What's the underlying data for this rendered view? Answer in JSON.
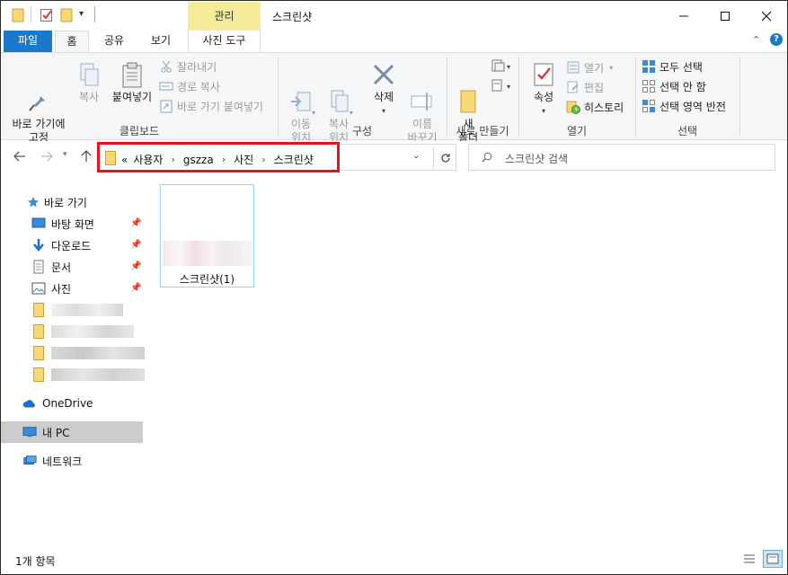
{
  "title_bar": {
    "manage_tab": "관리",
    "window_title": "스크린샷"
  },
  "ribbon_tabs": {
    "file": "파일",
    "home": "홈",
    "share": "공유",
    "view": "보기",
    "picture_tools": "사진 도구"
  },
  "ribbon": {
    "clipboard": {
      "pin_quick_access": "바로 가기에\n고정",
      "copy": "복사",
      "paste": "붙여넣기",
      "cut": "잘라내기",
      "copy_path": "경로 복사",
      "paste_shortcut": "바로 가기 붙여넣기",
      "group_label": "클립보드"
    },
    "organize": {
      "move_to": "이동\n위치",
      "copy_to": "복사\n위치",
      "delete": "삭제",
      "rename": "이름\n바꾸기",
      "group_label": "구성"
    },
    "new": {
      "new_folder": "새\n폴더",
      "group_label": "새로 만들기"
    },
    "open": {
      "properties": "속성",
      "open": "열기",
      "edit": "편집",
      "history": "히스토리",
      "group_label": "열기"
    },
    "select": {
      "select_all": "모두 선택",
      "select_none": "선택 안 함",
      "invert_selection": "선택 영역 반전",
      "group_label": "선택"
    }
  },
  "address_bar": {
    "overflow": "«",
    "crumbs": [
      "사용자",
      "gszza",
      "사진",
      "스크린샷"
    ]
  },
  "search": {
    "placeholder": "스크린샷 검색"
  },
  "nav_pane": {
    "quick_access": "바로 가기",
    "desktop": "바탕 화면",
    "downloads": "다운로드",
    "documents": "문서",
    "pictures": "사진",
    "onedrive": "OneDrive",
    "this_pc": "내 PC",
    "network": "네트워크"
  },
  "files": [
    {
      "name": "스크린샷(1)"
    }
  ],
  "status_bar": {
    "item_count": "1개 항목"
  },
  "colors": {
    "file_tab": "#1979ca",
    "manage_tab": "#f5ec9b",
    "highlight_box": "#e3141b",
    "selection_border": "#99d1ff"
  }
}
